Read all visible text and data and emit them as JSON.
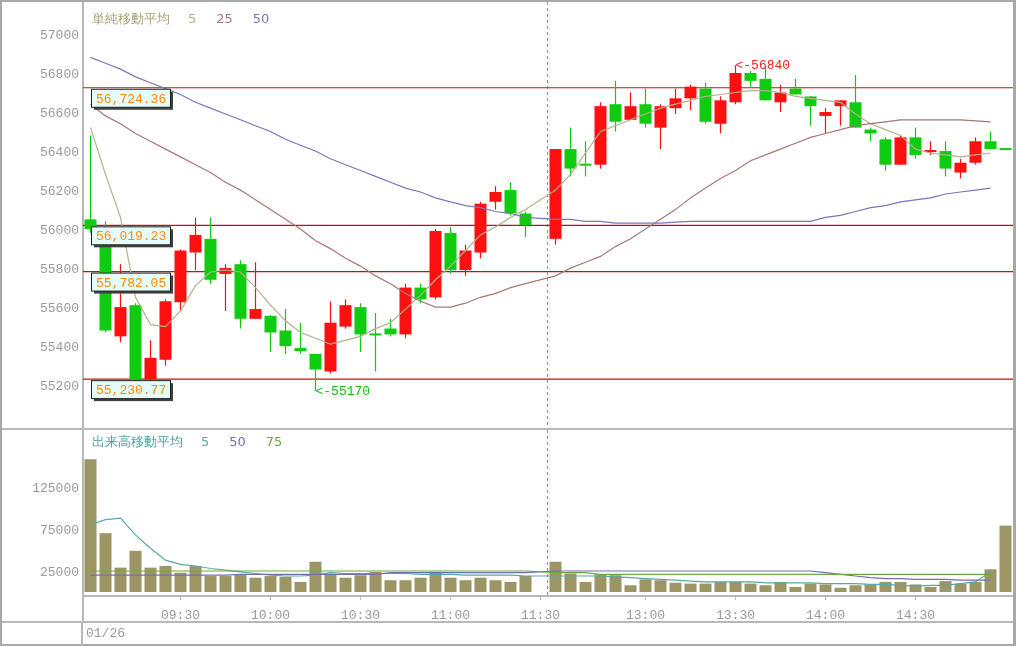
{
  "price_chart": {
    "chart_data": {
      "type": "candlestick",
      "title": "単純移動平均",
      "categories": [
        null,
        null,
        null,
        null,
        null,
        null,
        null,
        null,
        null,
        null,
        null,
        null,
        null,
        null,
        null,
        null,
        null,
        null,
        null,
        null,
        null,
        null,
        null,
        null,
        null,
        null,
        null,
        null,
        null,
        null,
        null,
        null,
        null,
        null,
        null,
        null,
        null,
        null,
        null,
        null,
        null,
        null,
        null,
        null,
        null,
        null,
        null,
        null,
        null,
        null,
        null,
        null,
        null,
        null,
        null,
        null,
        null,
        null,
        null,
        null,
        null,
        null
      ],
      "ylim": [
        54970,
        57164
      ],
      "yticks": [
        55200,
        55400,
        55600,
        55800,
        56000,
        56200,
        56400,
        56600,
        56800,
        57000
      ],
      "ohlc": [
        [
          56050,
          56480,
          55980,
          56000
        ],
        [
          56010,
          56040,
          55470,
          55480
        ],
        [
          55450,
          55820,
          55420,
          55600
        ],
        [
          55610,
          55620,
          55220,
          55230
        ],
        [
          55230,
          55430,
          55220,
          55340
        ],
        [
          55330,
          55640,
          55300,
          55630
        ],
        [
          55625,
          55895,
          55580,
          55890
        ],
        [
          55880,
          56060,
          55790,
          55970
        ],
        [
          55950,
          56060,
          55720,
          55740
        ],
        [
          55770,
          55820,
          55580,
          55800
        ],
        [
          55820,
          55840,
          55490,
          55540
        ],
        [
          55540,
          55830,
          55540,
          55590
        ],
        [
          55555,
          55560,
          55370,
          55470
        ],
        [
          55480,
          55590,
          55360,
          55400
        ],
        [
          55390,
          55520,
          55360,
          55375
        ],
        [
          55360,
          55360,
          55170,
          55280
        ],
        [
          55270,
          55630,
          55260,
          55520
        ],
        [
          55500,
          55640,
          55490,
          55610
        ],
        [
          55600,
          55620,
          55370,
          55460
        ],
        [
          55460,
          55570,
          55270,
          55450
        ],
        [
          55490,
          55540,
          55450,
          55460
        ],
        [
          55460,
          55720,
          55440,
          55700
        ],
        [
          55700,
          55720,
          55620,
          55640
        ],
        [
          55650,
          56000,
          55640,
          55990
        ],
        [
          55980,
          56010,
          55770,
          55790
        ],
        [
          55790,
          55920,
          55760,
          55890
        ],
        [
          55880,
          56140,
          55850,
          56130
        ],
        [
          56140,
          56220,
          56100,
          56190
        ],
        [
          56200,
          56240,
          56070,
          56080
        ],
        [
          56080,
          56090,
          55960,
          56020
        ],
        null,
        [
          55950,
          56410,
          55920,
          56410
        ],
        [
          56410,
          56520,
          56270,
          56310
        ],
        [
          56330,
          56450,
          56270,
          56320
        ],
        [
          56330,
          56650,
          56310,
          56630
        ],
        [
          56640,
          56760,
          56500,
          56550
        ],
        [
          56560,
          56700,
          56560,
          56630
        ],
        [
          56640,
          56720,
          56520,
          56540
        ],
        [
          56520,
          56640,
          56410,
          56630
        ],
        [
          56620,
          56720,
          56590,
          56670
        ],
        [
          56670,
          56740,
          56610,
          56730
        ],
        [
          56720,
          56750,
          56540,
          56550
        ],
        [
          56540,
          56680,
          56490,
          56660
        ],
        [
          56650,
          56840,
          56640,
          56800
        ],
        [
          56800,
          56810,
          56730,
          56760
        ],
        [
          56770,
          56830,
          56660,
          56660
        ],
        [
          56650,
          56740,
          56600,
          56700
        ],
        [
          56720,
          56770,
          56690,
          56690
        ],
        [
          56680,
          56680,
          56530,
          56630
        ],
        [
          56580,
          56620,
          56490,
          56600
        ],
        [
          56630,
          56660,
          56530,
          56660
        ],
        [
          56650,
          56790,
          56520,
          56520
        ],
        [
          56510,
          56520,
          56450,
          56490
        ],
        [
          56460,
          56470,
          56300,
          56330
        ],
        [
          56330,
          56480,
          56330,
          56470
        ],
        [
          56470,
          56520,
          56360,
          56380
        ],
        [
          56390,
          56450,
          56380,
          56400
        ],
        [
          56400,
          56450,
          56270,
          56310
        ],
        [
          56290,
          56360,
          56260,
          56340
        ],
        [
          56340,
          56470,
          56330,
          56450
        ],
        [
          56450,
          56500,
          56410,
          56410
        ],
        [
          56410,
          56410,
          56410,
          56410
        ]
      ],
      "series": [
        {
          "name": "5",
          "type": "line",
          "color": "#b4b08c",
          "values": [
            56520,
            56280,
            56060,
            55650,
            55510,
            55500,
            55580,
            55710,
            55780,
            55790,
            55780,
            55700,
            55610,
            55530,
            55470,
            55440,
            55410,
            55430,
            55450,
            55490,
            55520,
            55590,
            55660,
            55740,
            55810,
            55890,
            55970,
            56010,
            56060,
            56100,
            null,
            56200,
            56280,
            56390,
            56500,
            56530,
            56560,
            56590,
            56620,
            56640,
            56660,
            56680,
            56690,
            56700,
            56710,
            56710,
            56700,
            56680,
            56670,
            56660,
            56650,
            56590,
            56540,
            56510,
            56480,
            56410,
            56390,
            56380,
            56370,
            56380,
            56390,
            null
          ]
        },
        {
          "name": "25",
          "type": "line",
          "color": "#a87878",
          "values": [
            56640,
            56580,
            56540,
            56490,
            56450,
            56410,
            56370,
            56330,
            56290,
            56240,
            56200,
            56150,
            56100,
            56050,
            56000,
            55940,
            55900,
            55850,
            55810,
            55760,
            55720,
            55670,
            55630,
            55600,
            55600,
            55620,
            55650,
            55670,
            55700,
            55720,
            null,
            55760,
            55800,
            55830,
            55860,
            55910,
            55950,
            56000,
            56050,
            56100,
            56160,
            56210,
            56260,
            56300,
            56350,
            56380,
            56410,
            56440,
            56470,
            56490,
            56510,
            56530,
            56540,
            56550,
            56560,
            56560,
            56560,
            56560,
            56560,
            56555,
            56550,
            null
          ]
        },
        {
          "name": "50",
          "type": "line",
          "color": "#7878b8",
          "values": [
            56880,
            56850,
            56820,
            56780,
            56750,
            56720,
            56690,
            56650,
            56620,
            56590,
            56560,
            56530,
            56500,
            56460,
            56430,
            56400,
            56360,
            56330,
            56300,
            56270,
            56240,
            56210,
            56190,
            56160,
            56140,
            56120,
            56110,
            56090,
            56080,
            56060,
            null,
            56050,
            56050,
            56040,
            56040,
            56030,
            56030,
            56030,
            56030,
            56035,
            56040,
            56040,
            56040,
            56040,
            56040,
            56040,
            56040,
            56040,
            56040,
            56060,
            56070,
            56090,
            56110,
            56120,
            56140,
            56150,
            56160,
            56180,
            56190,
            56200,
            56210,
            null
          ]
        }
      ],
      "ref_lines": [
        {
          "axis": "y",
          "value": 56724.36,
          "label": "56,724.36"
        },
        {
          "axis": "y",
          "value": 56019.23,
          "label": "56,019.23"
        },
        {
          "axis": "y",
          "value": 55782.05,
          "label": "55,782.05"
        },
        {
          "axis": "y",
          "value": 55230.77,
          "label": "55,230.77"
        }
      ],
      "annotations": [
        "<-55170",
        "<-56840"
      ]
    }
  },
  "volume_chart": {
    "chart_data": {
      "type": "bar",
      "title": "出来高移動平均",
      "categories": [
        null,
        null,
        null,
        null,
        null,
        null,
        "09:30",
        null,
        null,
        null,
        null,
        null,
        "10:00",
        null,
        null,
        null,
        null,
        null,
        "10:30",
        null,
        null,
        null,
        null,
        null,
        "11:00",
        null,
        null,
        null,
        null,
        null,
        "11:30",
        null,
        null,
        null,
        null,
        null,
        null,
        "13:00",
        null,
        null,
        null,
        null,
        null,
        "13:30",
        null,
        null,
        null,
        null,
        null,
        "14:00",
        null,
        null,
        null,
        null,
        null,
        "14:30",
        null,
        null,
        null,
        null,
        null,
        null
      ],
      "values": [
        158000,
        70000,
        29000,
        49000,
        29000,
        31000,
        23000,
        31000,
        19000,
        19000,
        21000,
        17000,
        19000,
        18000,
        12000,
        36000,
        21000,
        17000,
        20000,
        24000,
        14000,
        14000,
        17000,
        24000,
        17000,
        14000,
        17000,
        14000,
        12000,
        19000,
        null,
        36000,
        22000,
        12000,
        21000,
        20000,
        8000,
        15000,
        14000,
        11000,
        10000,
        10000,
        12000,
        12000,
        10000,
        8000,
        12000,
        6000,
        10000,
        9000,
        5000,
        8000,
        9000,
        12000,
        12000,
        9000,
        6000,
        13000,
        10000,
        12000,
        27000,
        79000
      ],
      "series": [
        {
          "name": "5",
          "type": "line",
          "color": "#58a8a8",
          "values": [
            80000,
            86000,
            88000,
            68000,
            52000,
            38000,
            33000,
            31000,
            28000,
            26000,
            24000,
            22000,
            20000,
            19000,
            19000,
            20000,
            23000,
            22000,
            22000,
            22000,
            22000,
            22000,
            21000,
            21000,
            21000,
            20000,
            20000,
            20000,
            20000,
            19000,
            null,
            19000,
            19000,
            19000,
            19000,
            18000,
            17000,
            16000,
            15000,
            14000,
            13000,
            12000,
            12000,
            12000,
            12000,
            11000,
            11000,
            11000,
            11000,
            10000,
            10000,
            10000,
            9000,
            9000,
            8000,
            7000,
            8000,
            8000,
            10000,
            12000,
            24000,
            null
          ]
        },
        {
          "name": "50",
          "type": "line",
          "color": "#7070b0",
          "values": [
            20000,
            20000,
            20000,
            20000,
            20000,
            20000,
            20000,
            20000,
            20000,
            20000,
            21000,
            21000,
            21000,
            21000,
            21000,
            21000,
            21000,
            21000,
            21000,
            21000,
            23000,
            23000,
            23000,
            23000,
            23000,
            23000,
            23000,
            23000,
            23000,
            23000,
            null,
            25000,
            25000,
            25000,
            25000,
            25000,
            25000,
            25000,
            25000,
            25000,
            25000,
            25000,
            25000,
            25000,
            25000,
            25000,
            25000,
            25000,
            25000,
            23000,
            21000,
            19000,
            17000,
            16000,
            16000,
            15000,
            15000,
            15000,
            14000,
            14000,
            14000,
            null
          ]
        },
        {
          "name": "75",
          "type": "line",
          "color": "#70a840",
          "values": [
            25000,
            25000,
            25000,
            25000,
            25000,
            25000,
            25000,
            25000,
            25000,
            25000,
            25000,
            25000,
            25000,
            25000,
            25000,
            25000,
            25000,
            25000,
            25000,
            25000,
            25000,
            25000,
            25000,
            25000,
            25000,
            25000,
            25000,
            25000,
            25000,
            25000,
            null,
            23000,
            23000,
            23000,
            21000,
            21000,
            21000,
            21000,
            21000,
            21000,
            21000,
            21000,
            21000,
            21000,
            21000,
            21000,
            21000,
            21000,
            21000,
            21000,
            21000,
            21000,
            21000,
            21000,
            21000,
            21000,
            21000,
            21000,
            21000,
            21000,
            21000,
            null
          ]
        }
      ],
      "ylim": [
        0,
        192800
      ],
      "yticks": [
        25000,
        75000,
        125000
      ]
    }
  },
  "date_label": "01/26"
}
